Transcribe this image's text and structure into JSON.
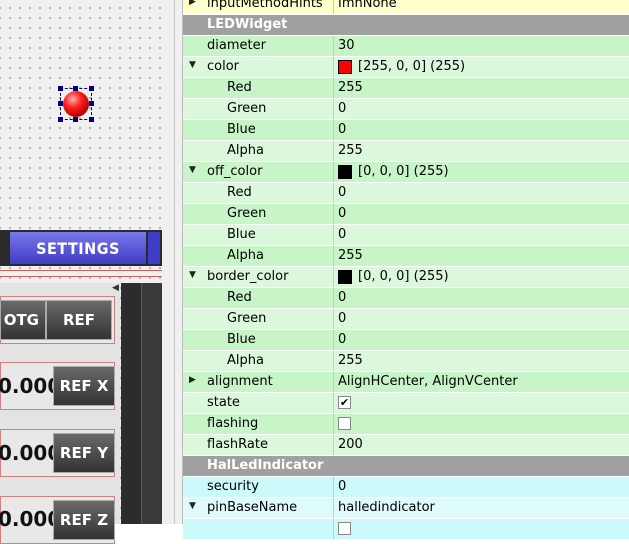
{
  "colors": {
    "green_row": "#c8f5c8",
    "green_row_alt": "#dcf8dc",
    "yellow_row": "#ffffcc",
    "cyan_row": "#ccfafa",
    "cyan_row_alt": "#dffafa",
    "header_row": "#a0a0a0",
    "red_swatch": "#ff0000",
    "black_swatch": "#000000"
  },
  "canvas": {
    "settings_label": "SETTINGS",
    "btn_otg": "OTG",
    "btn_ref": "REF",
    "btn_ref_x": "REF X",
    "btn_ref_y": "REF Y",
    "btn_ref_z": "REF Z",
    "value_x": "0.000",
    "value_y": "0.000",
    "value_z": "0.000"
  },
  "properties": [
    {
      "name": "inputMethodHints",
      "value": "ImhNone",
      "expand": "collapsed",
      "bg": "yellow"
    },
    {
      "name": "LEDWidget",
      "header": true
    },
    {
      "name": "diameter",
      "value": "30",
      "bg": "green"
    },
    {
      "name": "color",
      "value": "[255, 0, 0] (255)",
      "expand": "expanded",
      "swatch": "red",
      "bg": "green_alt"
    },
    {
      "name": "Red",
      "value": "255",
      "child": true,
      "bg": "green"
    },
    {
      "name": "Green",
      "value": "0",
      "child": true,
      "bg": "green_alt"
    },
    {
      "name": "Blue",
      "value": "0",
      "child": true,
      "bg": "green"
    },
    {
      "name": "Alpha",
      "value": "255",
      "child": true,
      "bg": "green_alt"
    },
    {
      "name": "off_color",
      "value": "[0, 0, 0] (255)",
      "expand": "expanded",
      "swatch": "black",
      "bg": "green"
    },
    {
      "name": "Red",
      "value": "0",
      "child": true,
      "bg": "green_alt"
    },
    {
      "name": "Green",
      "value": "0",
      "child": true,
      "bg": "green"
    },
    {
      "name": "Blue",
      "value": "0",
      "child": true,
      "bg": "green_alt"
    },
    {
      "name": "Alpha",
      "value": "255",
      "child": true,
      "bg": "green"
    },
    {
      "name": "border_color",
      "value": "[0, 0, 0] (255)",
      "expand": "expanded",
      "swatch": "black",
      "bg": "green_alt"
    },
    {
      "name": "Red",
      "value": "0",
      "child": true,
      "bg": "green"
    },
    {
      "name": "Green",
      "value": "0",
      "child": true,
      "bg": "green_alt"
    },
    {
      "name": "Blue",
      "value": "0",
      "child": true,
      "bg": "green"
    },
    {
      "name": "Alpha",
      "value": "255",
      "child": true,
      "bg": "green_alt"
    },
    {
      "name": "alignment",
      "value": "AlignHCenter, AlignVCenter",
      "expand": "collapsed",
      "bg": "green"
    },
    {
      "name": "state",
      "checkbox": true,
      "checked": true,
      "bg": "green_alt"
    },
    {
      "name": "flashing",
      "checkbox": true,
      "checked": false,
      "bg": "green"
    },
    {
      "name": "flashRate",
      "value": "200",
      "bg": "green_alt"
    },
    {
      "name": "HalLedIndicator",
      "header": true
    },
    {
      "name": "security",
      "value": "0",
      "bg": "cyan"
    },
    {
      "name": "pinBaseName",
      "value": "halledindicator",
      "expand": "expanded",
      "bg": "cyan_alt"
    },
    {
      "name": "",
      "checkbox": true,
      "checked": false,
      "bg": "cyan"
    }
  ]
}
